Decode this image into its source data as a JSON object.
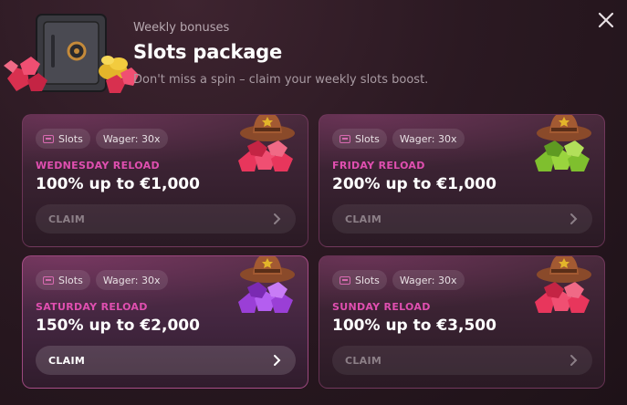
{
  "header": {
    "eyebrow": "Weekly bonuses",
    "title": "Slots package",
    "subtitle": "Don't miss a spin – claim your weekly slots boost."
  },
  "close_icon": "close-icon",
  "cards": [
    {
      "tag_game": "Slots",
      "tag_wager": "Wager: 30x",
      "label": "WEDNESDAY RELOAD",
      "offer": "100% up to €1,000",
      "claim": "CLAIM",
      "gem_color": "#e8365c",
      "active": false
    },
    {
      "tag_game": "Slots",
      "tag_wager": "Wager: 30x",
      "label": "FRIDAY RELOAD",
      "offer": "200% up to €1,000",
      "claim": "CLAIM",
      "gem_color": "#7fbf2e",
      "active": false
    },
    {
      "tag_game": "Slots",
      "tag_wager": "Wager: 30x",
      "label": "SATURDAY RELOAD",
      "offer": "150% up to €2,000",
      "claim": "CLAIM",
      "gem_color": "#9a3fd6",
      "active": true
    },
    {
      "tag_game": "Slots",
      "tag_wager": "Wager: 30x",
      "label": "SUNDAY RELOAD",
      "offer": "100% up to €3,500",
      "claim": "CLAIM",
      "gem_color": "#e8365c",
      "active": false
    }
  ],
  "colors": {
    "accent_pink": "#e04fb0",
    "background": "#2b1922"
  }
}
